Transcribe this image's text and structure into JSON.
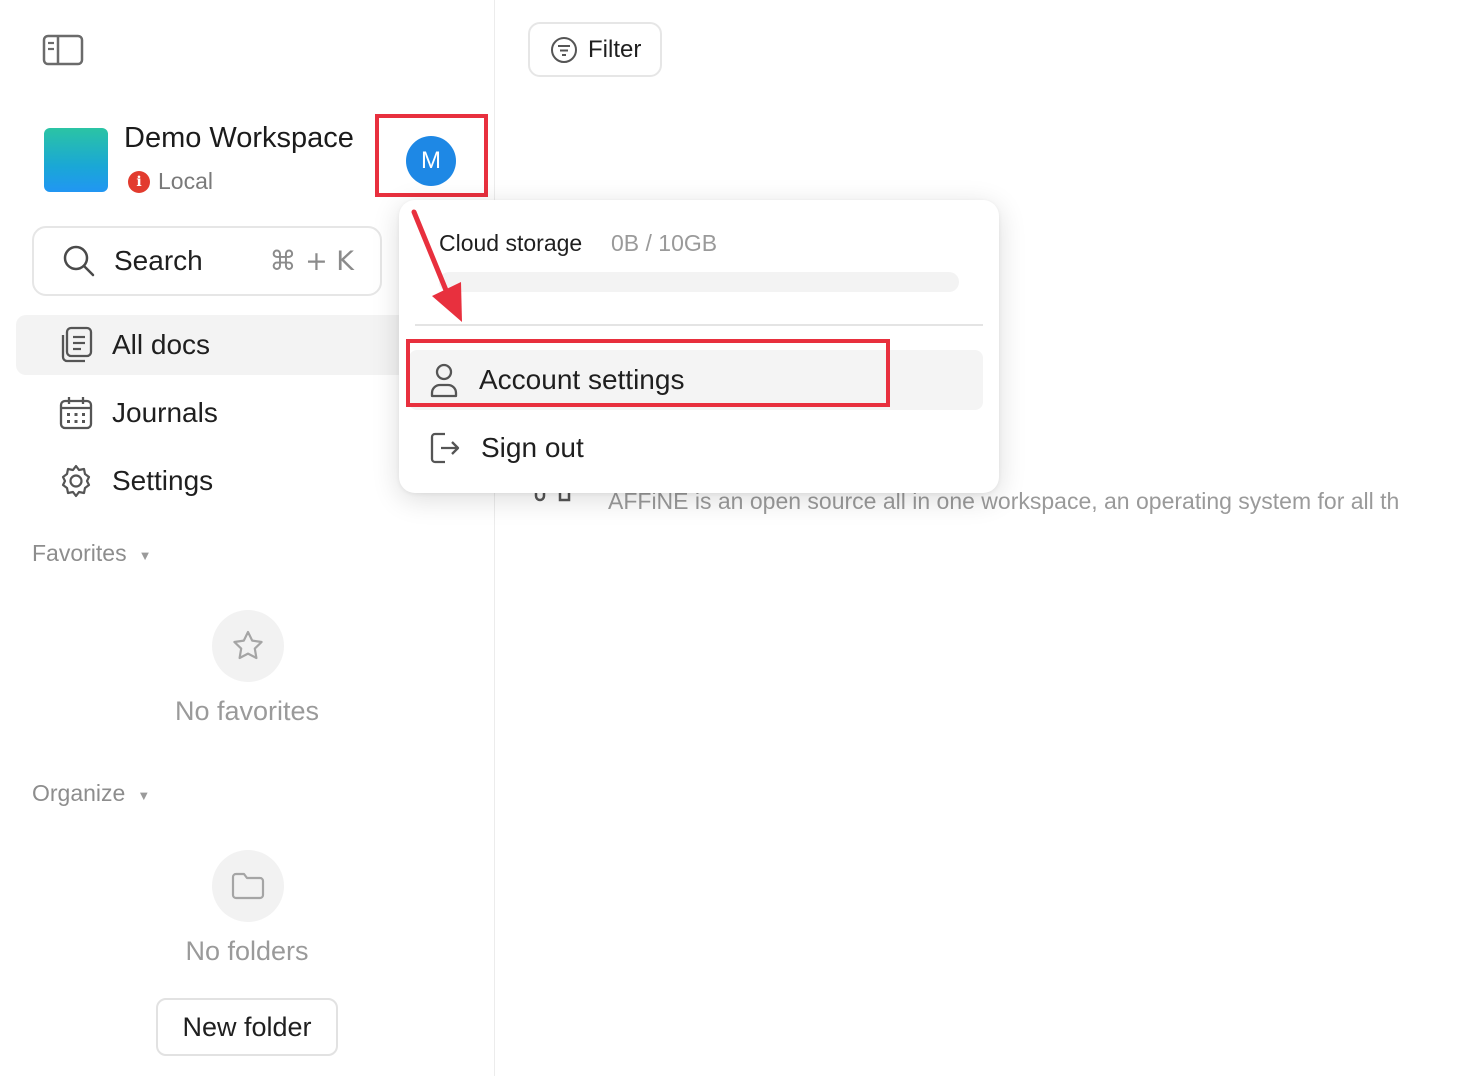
{
  "sidebar": {
    "workspace": {
      "name": "Demo Workspace",
      "status": "Local",
      "status_icon": "info-icon"
    },
    "user_avatar_initial": "M",
    "search": {
      "label": "Search",
      "shortcut": "⌘ + K"
    },
    "nav": [
      {
        "label": "All docs",
        "icon": "docs-icon",
        "active": true
      },
      {
        "label": "Journals",
        "icon": "calendar-icon",
        "active": false
      },
      {
        "label": "Settings",
        "icon": "gear-icon",
        "active": false
      }
    ],
    "favorites": {
      "header": "Favorites",
      "empty_text": "No favorites"
    },
    "organize": {
      "header": "Organize",
      "empty_text": "No folders",
      "new_folder_label": "New folder"
    }
  },
  "main": {
    "filter_label": "Filter",
    "doc_description": "AFFiNE is an open source all in one workspace, an operating system for all th"
  },
  "account_menu": {
    "storage_label": "Cloud storage",
    "storage_value": "0B / 10GB",
    "storage_used_fraction": 0,
    "items": [
      {
        "label": "Account settings",
        "icon": "user-icon"
      },
      {
        "label": "Sign out",
        "icon": "sign-out-icon"
      }
    ]
  },
  "colors": {
    "highlight": "#e8303e",
    "avatar_blue": "#1e88e5",
    "status_red": "#e23b2e"
  }
}
